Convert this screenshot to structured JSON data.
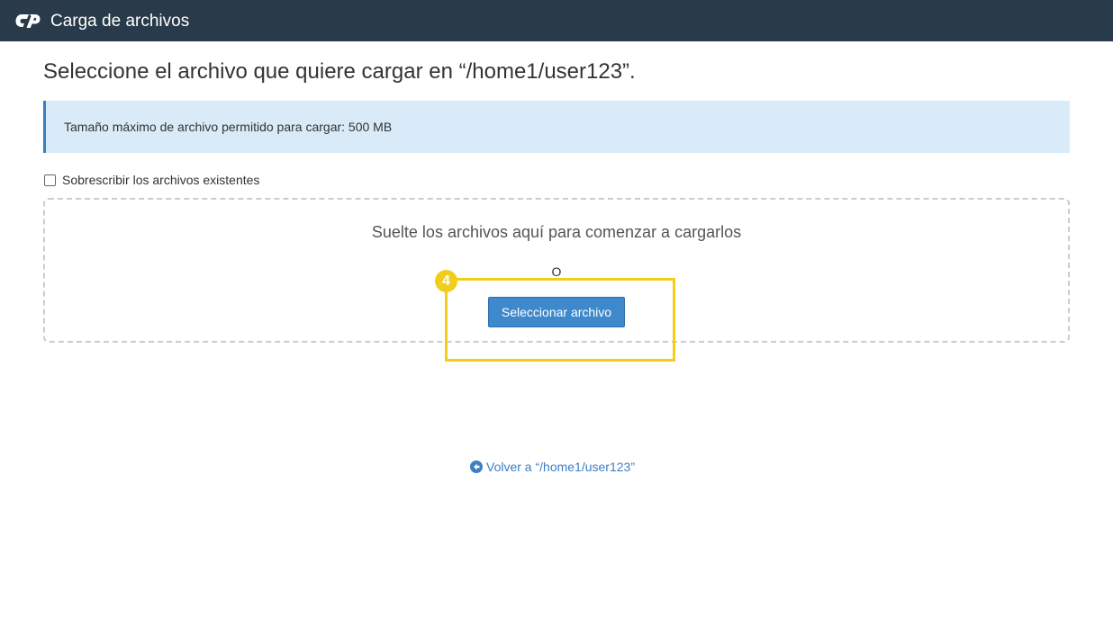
{
  "header": {
    "title": "Carga de archivos",
    "logo_icon": "cpanel-logo-icon",
    "background": "#293a4a"
  },
  "main": {
    "heading": "Seleccione el archivo que quiere cargar en “/home1/user123”.",
    "info": "Tamaño máximo de archivo permitido para cargar: 500 MB",
    "overwrite_label": "Sobrescribir los archivos existentes",
    "overwrite_checked": false,
    "dropzone_text": "Suelte los archivos aquí para comenzar a cargarlos",
    "or_text": "O",
    "select_button": "Seleccionar archivo",
    "step_badge": "4",
    "back_link": "Volver a “/home1/user123”",
    "back_icon": "arrow-circle-left-icon"
  },
  "colors": {
    "accent": "#3e89cc",
    "info_bg": "#d9ebf8",
    "highlight": "#f2cd1c",
    "link": "#3b7fc4"
  }
}
